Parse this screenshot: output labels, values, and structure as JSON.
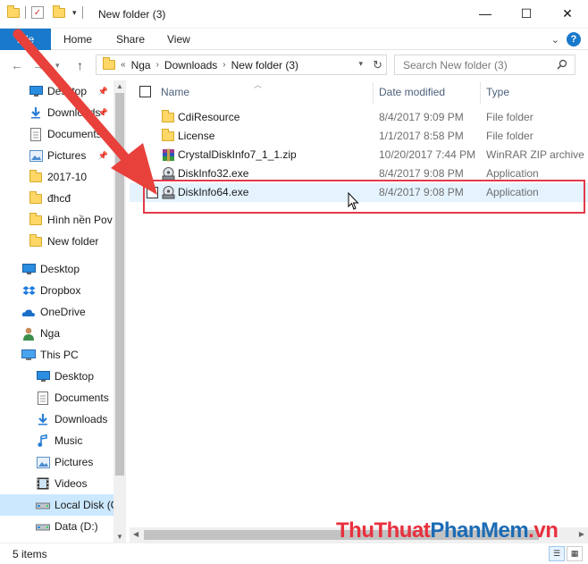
{
  "window": {
    "title": "New folder (3)",
    "minimize_glyph": "—",
    "maximize_glyph": "☐",
    "close_glyph": "✕"
  },
  "ribbon": {
    "file_tab": "File",
    "tabs": [
      "Home",
      "Share",
      "View"
    ]
  },
  "address": {
    "overflow": "«",
    "crumbs": [
      "Nga",
      "Downloads",
      "New folder (3)"
    ],
    "separator": "›"
  },
  "search": {
    "placeholder": "Search New folder (3)"
  },
  "nav": {
    "quick_access": [
      {
        "label": "Desktop",
        "icon": "desktop-icon",
        "pinned": true
      },
      {
        "label": "Downloads",
        "icon": "download-icon",
        "pinned": true
      },
      {
        "label": "Documents",
        "icon": "document-icon",
        "pinned": true
      },
      {
        "label": "Pictures",
        "icon": "pictures-icon",
        "pinned": true
      },
      {
        "label": "2017-10",
        "icon": "folder-icon",
        "pinned": false
      },
      {
        "label": "đhcđ",
        "icon": "folder-icon",
        "pinned": false
      },
      {
        "label": "Hình nền Pov",
        "icon": "folder-icon",
        "pinned": false
      },
      {
        "label": "New folder",
        "icon": "folder-icon",
        "pinned": false
      }
    ],
    "root": [
      {
        "label": "Desktop",
        "icon": "desktop-icon"
      },
      {
        "label": "Dropbox",
        "icon": "dropbox-icon"
      },
      {
        "label": "OneDrive",
        "icon": "onedrive-icon"
      },
      {
        "label": "Nga",
        "icon": "user-icon"
      },
      {
        "label": "This PC",
        "icon": "pc-icon"
      }
    ],
    "this_pc": [
      {
        "label": "Desktop",
        "icon": "desktop-icon"
      },
      {
        "label": "Documents",
        "icon": "document-icon"
      },
      {
        "label": "Downloads",
        "icon": "download-icon"
      },
      {
        "label": "Music",
        "icon": "music-icon"
      },
      {
        "label": "Pictures",
        "icon": "pictures-icon"
      },
      {
        "label": "Videos",
        "icon": "videos-icon"
      },
      {
        "label": "Local Disk (C:)",
        "icon": "drive-icon",
        "selected": true
      },
      {
        "label": "Data (D:)",
        "icon": "drive-icon"
      }
    ]
  },
  "columns": {
    "name": "Name",
    "date": "Date modified",
    "type": "Type"
  },
  "files": [
    {
      "name": "CdiResource",
      "date": "8/4/2017 9:09 PM",
      "type": "File folder",
      "icon": "folder-icon"
    },
    {
      "name": "License",
      "date": "1/1/2017 8:58 PM",
      "type": "File folder",
      "icon": "folder-icon"
    },
    {
      "name": "CrystalDiskInfo7_1_1.zip",
      "date": "10/20/2017 7:44 PM",
      "type": "WinRAR ZIP archive",
      "icon": "winrar-icon"
    },
    {
      "name": "DiskInfo32.exe",
      "date": "8/4/2017 9:08 PM",
      "type": "Application",
      "icon": "diskinfo-icon"
    },
    {
      "name": "DiskInfo64.exe",
      "date": "8/4/2017 9:08 PM",
      "type": "Application",
      "icon": "diskinfo-icon",
      "highlighted": true
    }
  ],
  "status": {
    "items": "5 items"
  },
  "watermark": {
    "part1": "ThuThuat",
    "part2": "PhanMem",
    "part3": ".vn"
  },
  "colors": {
    "accent": "#1979ca",
    "highlight_box": "#e33a4a",
    "arrow": "#e8413c"
  }
}
